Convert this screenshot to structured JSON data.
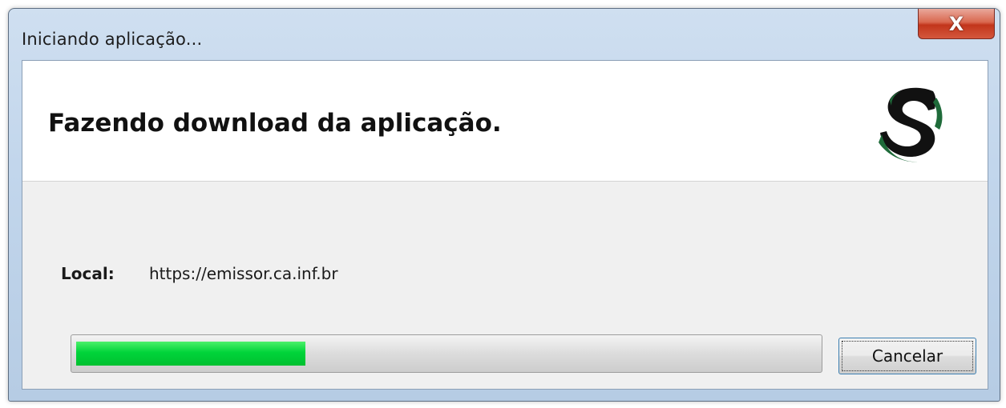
{
  "window": {
    "title": "Iniciando aplicação...",
    "close_glyph": "X"
  },
  "header": {
    "title": "Fazendo download da aplicação.",
    "logo_icon": "s-logo-icon",
    "logo_colors": [
      "#111111",
      "#1f6b3a"
    ]
  },
  "location": {
    "label": "Local:",
    "url": "https://emissor.ca.inf.br"
  },
  "progress": {
    "fraction": 0.31,
    "color": "#00d43a"
  },
  "actions": {
    "cancel_label": "Cancelar"
  }
}
